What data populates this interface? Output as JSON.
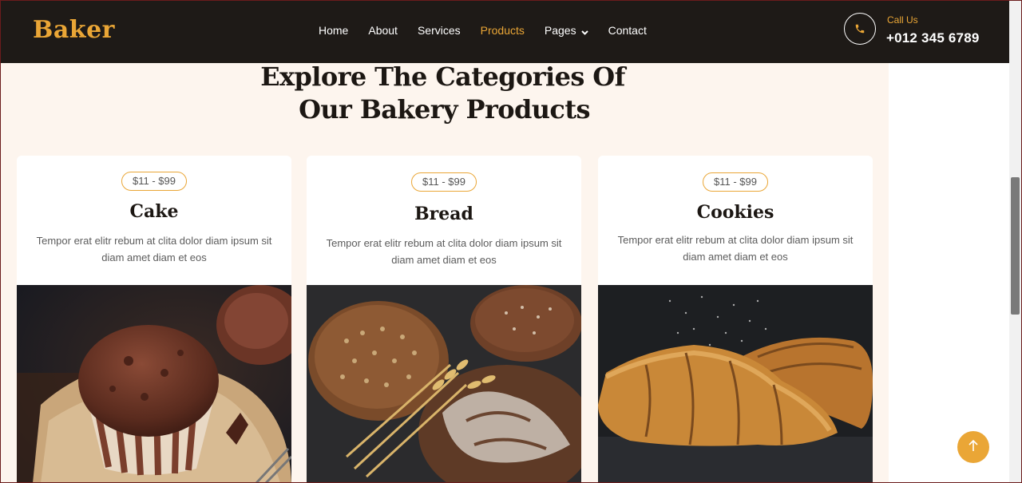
{
  "brand": {
    "name": "Baker"
  },
  "nav": {
    "items": [
      {
        "label": "Home"
      },
      {
        "label": "About"
      },
      {
        "label": "Services"
      },
      {
        "label": "Products"
      },
      {
        "label": "Pages"
      },
      {
        "label": "Contact"
      }
    ],
    "active": "Products"
  },
  "contact": {
    "label": "Call Us",
    "phone": "+012 345 6789",
    "icon": "phone-icon"
  },
  "section": {
    "heading_line1": "Explore The Categories Of",
    "heading_line2": "Our Bakery Products"
  },
  "products": [
    {
      "price": "$11 - $99",
      "title": "Cake",
      "description": "Tempor erat elitr rebum at clita dolor diam ipsum sit diam amet diam et eos"
    },
    {
      "price": "$11 - $99",
      "title": "Bread",
      "description": "Tempor erat elitr rebum at clita dolor diam ipsum sit diam amet diam et eos"
    },
    {
      "price": "$11 - $99",
      "title": "Cookies",
      "description": "Tempor erat elitr rebum at clita dolor diam ipsum sit diam amet diam et eos"
    }
  ],
  "colors": {
    "accent": "#eaa636",
    "nav_bg": "#1e1a17",
    "section_bg": "#fdf5ee",
    "heading": "#1c1713"
  },
  "icons": {
    "back_to_top": "arrow-up-icon",
    "dropdown": "chevron-down-icon"
  }
}
